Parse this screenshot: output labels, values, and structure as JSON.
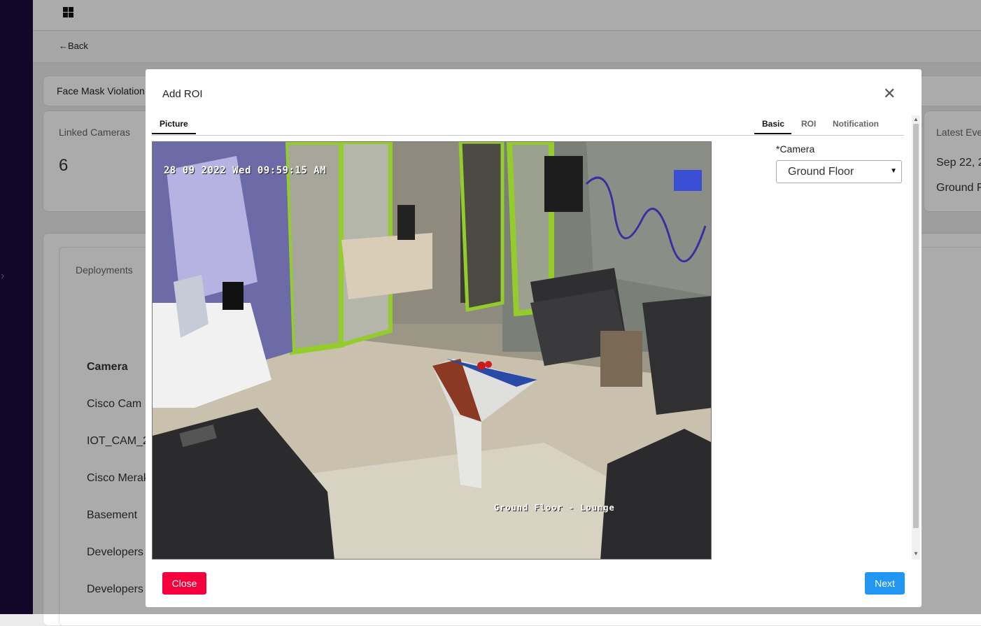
{
  "nav": {
    "back_label": "Back",
    "sidebar_toggle": "›"
  },
  "page": {
    "title_card": "Face Mask Violation",
    "linked_cameras_label": "Linked Cameras",
    "linked_cameras_count": "6",
    "latest_events_label": "Latest Eve",
    "latest_event_date": "Sep 22, 2",
    "latest_event_location": "Ground F",
    "deployments_label": "Deployments",
    "table": {
      "header": "Camera",
      "rows": [
        "Cisco Cam I",
        "IOT_CAM_2",
        "Cisco Merak",
        "Basement",
        "Developers",
        "Developers"
      ]
    }
  },
  "modal": {
    "title": "Add ROI",
    "tabs": {
      "picture": "Picture",
      "basic": "Basic",
      "roi": "ROI",
      "notification": "Notification"
    },
    "camera_label": "*Camera",
    "camera_value": "Ground Floor",
    "close_button": "Close",
    "next_button": "Next",
    "feed": {
      "timestamp": "28 09 2022 Wed 09:59:15 AM",
      "location_overlay": "Ground Floor - Lounge"
    }
  },
  "colors": {
    "accent": "#2196f3",
    "danger": "#f5003d",
    "sidebar": "#1f0a3c"
  },
  "icons": [
    "grid-icon",
    "arrow-left-icon",
    "close-icon",
    "chevron-down-icon",
    "chevron-right-icon"
  ]
}
